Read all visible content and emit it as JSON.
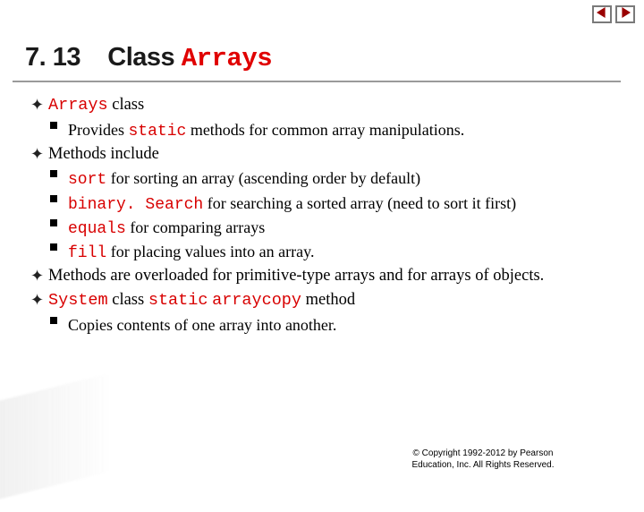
{
  "nav": {
    "prev_icon": "nav-prev-icon",
    "next_icon": "nav-next-icon"
  },
  "title": {
    "section_number": "7. 13",
    "word_class": "Class",
    "word_arrays": "Arrays"
  },
  "bullets": {
    "b1": {
      "arrays": "Arrays",
      "text_after": " class"
    },
    "b1_sub1": {
      "pre": "Provides ",
      "kw": "static",
      "post": " methods for common array manipulations."
    },
    "b2": {
      "text": "Methods include"
    },
    "b2_sub1": {
      "kw": "sort",
      "post": " for sorting an array (ascending order by default)"
    },
    "b2_sub2": {
      "kw": "binary. Search",
      "post": " for searching a sorted array (need to sort it first)"
    },
    "b2_sub3": {
      "kw": "equals",
      "post": " for comparing arrays"
    },
    "b2_sub4": {
      "kw": "fill",
      "post": " for placing values into an array."
    },
    "b3": {
      "text": "Methods are overloaded for primitive-type arrays and for arrays of objects."
    },
    "b4": {
      "kw1": "System",
      "mid1": " class ",
      "kw2": "static",
      "mid2": " ",
      "kw3": "arraycopy",
      "post": " method"
    },
    "b4_sub1": {
      "text": "Copies contents of one array into another."
    }
  },
  "footer": {
    "line1": "© Copyright 1992-2012 by Pearson",
    "line2": "Education, Inc. All Rights Reserved."
  }
}
